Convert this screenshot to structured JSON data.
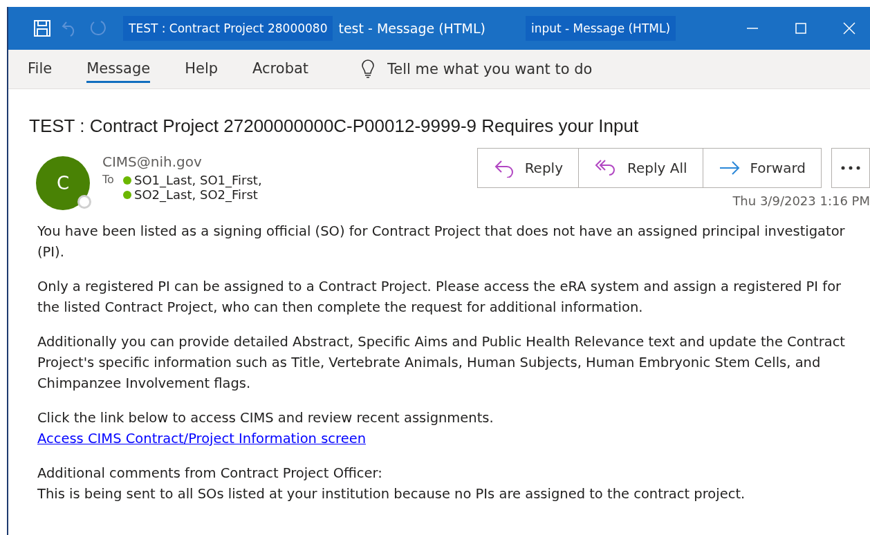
{
  "window": {
    "titles": [
      "TEST : Contract Project 28000080",
      "test  -  Message (HTML)",
      "input  -  Message (HTML)"
    ]
  },
  "menu": {
    "tabs": [
      {
        "label": "File",
        "selected": false
      },
      {
        "label": "Message",
        "selected": true
      },
      {
        "label": "Help",
        "selected": false
      },
      {
        "label": "Acrobat",
        "selected": false
      }
    ],
    "search": {
      "placeholder": "Tell me what you want to do"
    }
  },
  "message": {
    "subject": "TEST : Contract Project 27200000000C-P00012-9999-9 Requires your Input",
    "avatar": "C",
    "sender": "CIMS@nih.gov",
    "to_label": "To",
    "recipients": [
      {
        "name": "SO1_Last, SO1_First,",
        "color": "#6bb700"
      },
      {
        "name": "SO2_Last, SO2_First",
        "color": "#6bb700"
      }
    ],
    "actions": [
      {
        "kind": "reply",
        "label": "Reply"
      },
      {
        "kind": "reply_all",
        "label": "Reply All"
      },
      {
        "kind": "forward",
        "label": "Forward"
      }
    ],
    "date": "Thu 3/9/2023 1:16 PM",
    "body": [
      {
        "kind": "text",
        "lines": [
          "You have been listed as a signing official (SO) for Contract Project that does not have an assigned principal investigator (PI)."
        ]
      },
      {
        "kind": "text",
        "lines": [
          "Only a registered PI can be assigned to a Contract Project. Please access the eRA system and assign a registered PI for the listed Contract Project, who can then complete the request for additional information."
        ]
      },
      {
        "kind": "text",
        "lines": [
          "Additionally you can provide detailed Abstract, Specific Aims and Public Health Relevance text and update the Contract Project's specific information such as Title, Vertebrate Animals, Human Subjects, Human Embryonic Stem Cells, and Chimpanzee Involvement flags."
        ]
      },
      {
        "kind": "link",
        "lines": [
          "Click the link below to access CIMS and review recent assignments."
        ],
        "link": "Access CIMS Contract/Project Information screen"
      },
      {
        "kind": "text",
        "lines": [
          "Additional comments from Contract Project Officer:",
          "This is being sent to all SOs listed at your institution because no PIs are assigned to the contract project."
        ]
      }
    ]
  }
}
